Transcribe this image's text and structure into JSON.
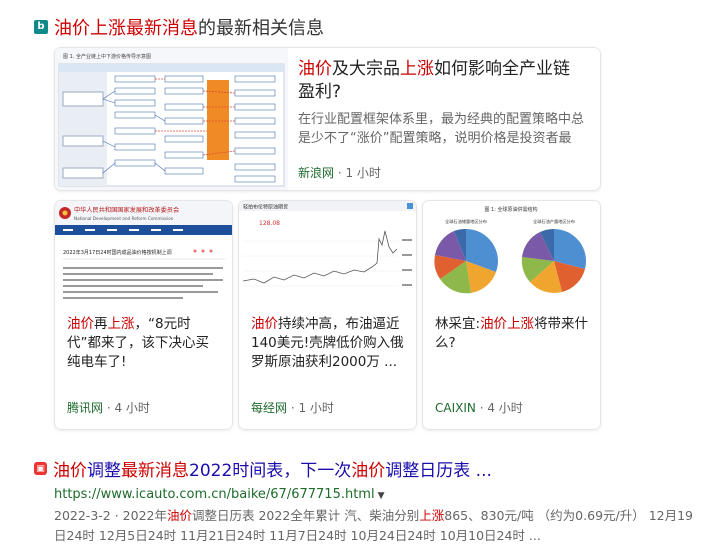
{
  "header": {
    "title_highlight": "油价上涨最新消息",
    "title_rest": "的最新相关信息"
  },
  "featured": {
    "title_parts": [
      "油价",
      "及大宗品",
      "上涨",
      "如何影响全产业链盈利?"
    ],
    "snippet": "在行业配置框架体系里，最为经典的配置策略中总是少不了“涨价”配置策略，说明价格是投资者最 ...",
    "source": "新浪网",
    "time": "1 小时",
    "thumb_caption": "图 1. 全产业链上中下游价格传导示意图"
  },
  "cards": [
    {
      "title_parts": [
        "油价",
        "再",
        "上涨",
        "，“8元时代”都来了，该下决心买纯电车了!"
      ],
      "source": "腾讯网",
      "time": "4 小时",
      "thumb_org_cn": "中华人民共和国国家发展和改革委员会",
      "thumb_org_en": "National Development and Reform Commission",
      "thumb_headline": "2022年3月17日24时国内成品油价格按机制上调"
    },
    {
      "title_parts": [
        "油价",
        "持续冲高，布油逼近140美元!壳牌低价购入俄罗斯原油获利2000万 ..."
      ],
      "source": "每经网",
      "time": "1 小时",
      "thumb_label": "轻拍布伦特原油期货",
      "thumb_price": "128.08"
    },
    {
      "title_parts": [
        "林采宜:",
        "油价",
        "上涨",
        "将带来什么?"
      ],
      "source": "CAIXIN",
      "time": "4 小时",
      "thumb_caption": "图 1: 全球原油供需结构",
      "pie1_label": "全球石油储量地区分布",
      "pie2_label": "全球石油产量地区分布"
    }
  ],
  "result": {
    "title_parts": [
      "油价",
      "调整",
      "最新消息",
      "2022时间表，下一次",
      "油价",
      "调整日历表 ..."
    ],
    "url": "https://www.icauto.com.cn/baike/67/677715.html",
    "snippet_parts": [
      "2022-3-2 · 2022年",
      "油价",
      "调整日历表 2022全年累计 汽、柴油分别",
      "上涨",
      "865、830元/吨 （约为0.69元/升） 12月19日24时 12月5日24时 11月21日24时 11月7日24时 10月24日24时 10月10日24时 ..."
    ]
  }
}
